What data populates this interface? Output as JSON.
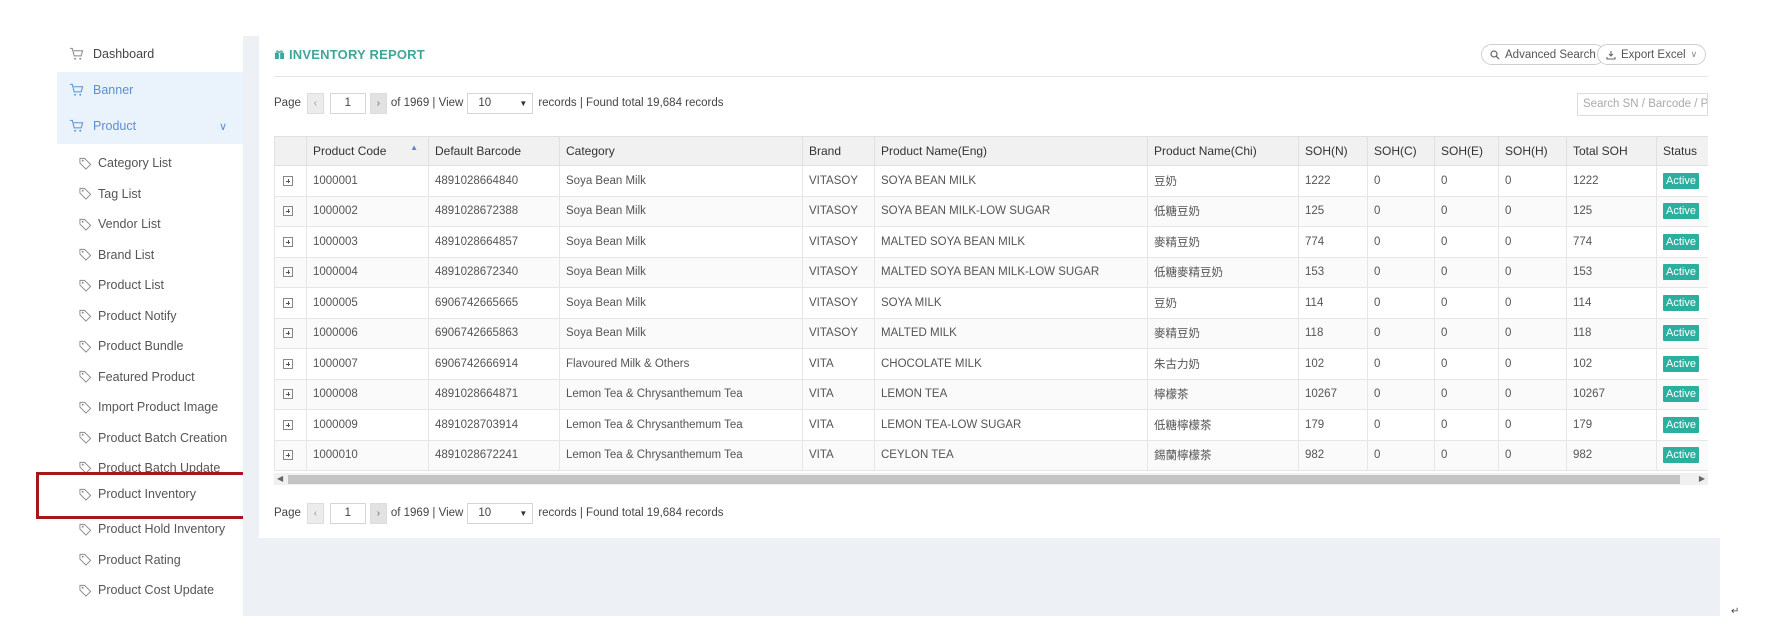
{
  "sidebar": {
    "top_items": [
      {
        "label": "Dashboard"
      },
      {
        "label": "Banner"
      },
      {
        "label": "Product"
      }
    ],
    "sub_items": [
      {
        "label": "Category List"
      },
      {
        "label": "Tag List"
      },
      {
        "label": "Vendor List"
      },
      {
        "label": "Brand List"
      },
      {
        "label": "Product List"
      },
      {
        "label": "Product Notify"
      },
      {
        "label": "Product Bundle"
      },
      {
        "label": "Featured Product"
      },
      {
        "label": "Import Product Image"
      },
      {
        "label": "Product Batch Creation"
      },
      {
        "label": "Product Batch Update"
      },
      {
        "label": "Product Inventory"
      },
      {
        "label": "Product Hold Inventory"
      },
      {
        "label": "Product Rating"
      },
      {
        "label": "Product Cost Update"
      }
    ]
  },
  "header": {
    "title": "INVENTORY REPORT",
    "advanced_search": "Advanced Search",
    "export_excel": "Export Excel"
  },
  "pager": {
    "page_label": "Page",
    "prev": "‹",
    "next": "›",
    "page_value": "1",
    "of_text": "of 1969 | View",
    "view_value": "10",
    "records_text": "records | Found total 19,684 records"
  },
  "search": {
    "placeholder": "Search SN / Barcode / Pr"
  },
  "table": {
    "columns": [
      "",
      "Product Code",
      "Default Barcode",
      "Category",
      "Brand",
      "Product Name(Eng)",
      "Product Name(Chi)",
      "SOH(N)",
      "SOH(C)",
      "SOH(E)",
      "SOH(H)",
      "Total SOH",
      "Status"
    ],
    "rows": [
      [
        "1000001",
        "4891028664840",
        "Soya Bean Milk",
        "VITASOY",
        "SOYA BEAN MILK",
        "豆奶",
        "1222",
        "0",
        "0",
        "0",
        "1222",
        "Active"
      ],
      [
        "1000002",
        "4891028672388",
        "Soya Bean Milk",
        "VITASOY",
        "SOYA BEAN MILK-LOW SUGAR",
        "低糖豆奶",
        "125",
        "0",
        "0",
        "0",
        "125",
        "Active"
      ],
      [
        "1000003",
        "4891028664857",
        "Soya Bean Milk",
        "VITASOY",
        "MALTED SOYA BEAN MILK",
        "麥精豆奶",
        "774",
        "0",
        "0",
        "0",
        "774",
        "Active"
      ],
      [
        "1000004",
        "4891028672340",
        "Soya Bean Milk",
        "VITASOY",
        "MALTED SOYA BEAN MILK-LOW SUGAR",
        "低糖麥精豆奶",
        "153",
        "0",
        "0",
        "0",
        "153",
        "Active"
      ],
      [
        "1000005",
        "6906742665665",
        "Soya Bean Milk",
        "VITASOY",
        "SOYA MILK",
        "豆奶",
        "114",
        "0",
        "0",
        "0",
        "114",
        "Active"
      ],
      [
        "1000006",
        "6906742665863",
        "Soya Bean Milk",
        "VITASOY",
        "MALTED MILK",
        "麥精豆奶",
        "118",
        "0",
        "0",
        "0",
        "118",
        "Active"
      ],
      [
        "1000007",
        "6906742666914",
        "Flavoured Milk & Others",
        "VITA",
        "CHOCOLATE MILK",
        "朱古力奶",
        "102",
        "0",
        "0",
        "0",
        "102",
        "Active"
      ],
      [
        "1000008",
        "4891028664871",
        "Lemon Tea & Chrysanthemum Tea",
        "VITA",
        "LEMON TEA",
        "檸檬茶",
        "10267",
        "0",
        "0",
        "0",
        "10267",
        "Active"
      ],
      [
        "1000009",
        "4891028703914",
        "Lemon Tea & Chrysanthemum Tea",
        "VITA",
        "LEMON TEA-LOW SUGAR",
        "低糖檸檬茶",
        "179",
        "0",
        "0",
        "0",
        "179",
        "Active"
      ],
      [
        "1000010",
        "4891028672241",
        "Lemon Tea & Chrysanthemum Tea",
        "VITA",
        "CEYLON TEA",
        "錫蘭檸檬茶",
        "982",
        "0",
        "0",
        "0",
        "982",
        "Active"
      ]
    ]
  },
  "colors": {
    "accent": "#3fa79a",
    "nav_active": "#5b8fd3",
    "highlight": "#a3171d",
    "badge": "#2bb0a0"
  }
}
